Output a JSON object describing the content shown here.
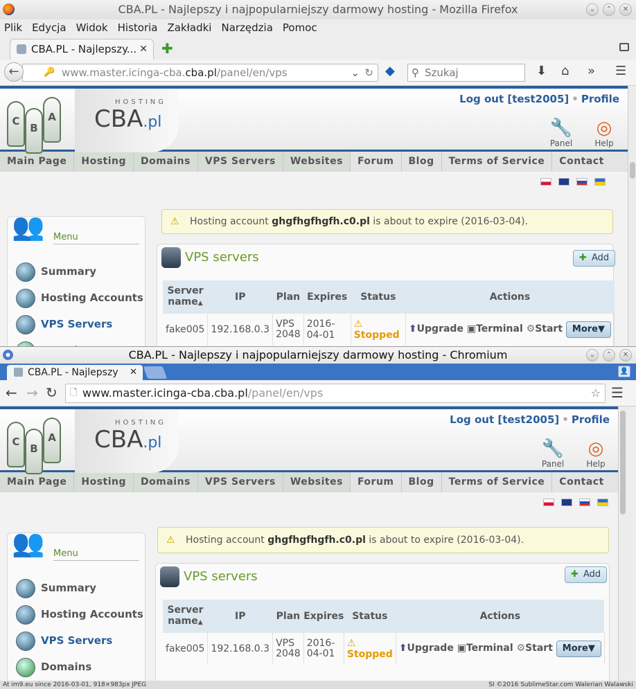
{
  "firefox": {
    "title": "CBA.PL - Najlepszy i najpopularniejszy darmowy hosting - Mozilla Firefox",
    "menu": [
      "Plik",
      "Edycja",
      "Widok",
      "Historia",
      "Zakładki",
      "Narzędzia",
      "Pomoc"
    ],
    "tab_label": "CBA.PL - Najlepszy...",
    "url_prefix": "www.master.icinga-cba.",
    "url_domain": "cba.pl",
    "url_path": "/panel/en/vps",
    "search_placeholder": "Szukaj"
  },
  "chromium": {
    "title": "CBA.PL - Najlepszy i najpopularniejszy darmowy hosting - Chromium",
    "tab_label": "CBA.PL - Najlepszy",
    "url_host": "www.master.icinga-cba.cba.pl",
    "url_path": "/panel/en/vps"
  },
  "site": {
    "hosting_label": "HOSTING",
    "brand": "CBA",
    "brand_tld": ".pl",
    "logout": "Log out [test2005]",
    "profile": "Profile",
    "panel_label": "Panel",
    "help_label": "Help",
    "nav": [
      "Main Page",
      "Hosting",
      "Domains",
      "VPS Servers",
      "Websites",
      "Forum",
      "Blog",
      "Terms of Service",
      "Contact"
    ],
    "menu_title": "Menu",
    "sidebar": [
      "Summary",
      "Hosting Accounts",
      "VPS Servers",
      "Domains"
    ],
    "alert_pre": "Hosting account ",
    "alert_account": "ghgfhgfhgfh.c0.pl",
    "alert_post": " is about to expire (2016-03-04).",
    "panel_title": "VPS servers",
    "add_label": "Add",
    "table": {
      "headers": [
        "Server name",
        "IP",
        "Plan",
        "Expires",
        "Status",
        "Actions"
      ],
      "row": {
        "name": "fake005",
        "ip": "192.168.0.3",
        "plan": "VPS 2048",
        "expires": "2016-04-01",
        "status": "Stopped",
        "upgrade": "Upgrade",
        "terminal": "Terminal",
        "start": "Start",
        "more": "More▼"
      }
    }
  },
  "footer": {
    "left": "At im9.eu since 2016-03-01, 918×983px JPEG",
    "right": "SI ©2016 SublimeStar.com Walerian Walawski"
  },
  "colors": {
    "brand_blue": "#2b5d9a",
    "menu_green": "#6a9a2a",
    "stopped_orange": "#e89a00"
  }
}
